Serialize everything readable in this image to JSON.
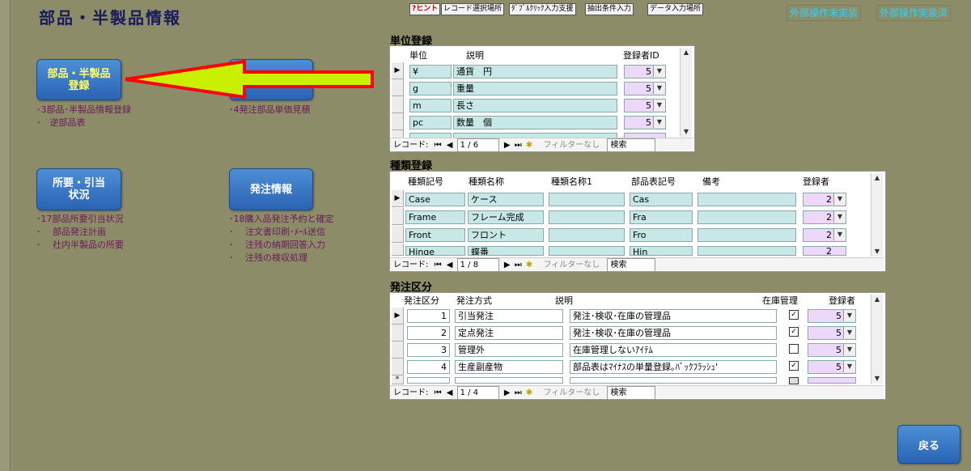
{
  "page": {
    "title": "部品・半製品情報"
  },
  "toolbar": {
    "hint": "?ヒント",
    "record_select": "レコード選択場所",
    "double_click": "ﾀﾞﾌﾞﾙｸﾘｯｸ入力支援",
    "filter_cond": "抽出条件入力",
    "data_entry": "データ入力場所",
    "ext_not_impl": "外部操作未実装",
    "ext_impl": "外部操作実装済"
  },
  "nav_buttons": {
    "parts": "部品・半製品\n登録",
    "req": "所要・引当\n状況",
    "order": "発注情報"
  },
  "descriptions": {
    "parts": "･3部品･半製品情報登録\n･　逆部品表",
    "price": "･4発注部品単価見積",
    "req": "･17部品所要引当状況\n･　 部品発注計画\n･　 社内半製品の所要",
    "order": "･18購入品発注予約と確定\n･　 注文書印刷･ﾒｰﾙ送信\n･　 注残の納期回答入力\n･　 注残の検収処理"
  },
  "unit_section": {
    "title": "単位登録",
    "headers": [
      "単位",
      "説明",
      "登録者ID"
    ],
    "rows": [
      {
        "unit": "¥",
        "desc": "通貨　円",
        "id": "5"
      },
      {
        "unit": "g",
        "desc": "重量",
        "id": "5"
      },
      {
        "unit": "m",
        "desc": "長さ",
        "id": "5"
      },
      {
        "unit": "pc",
        "desc": "数量　個",
        "id": "5"
      },
      {
        "unit": "",
        "desc": "",
        "id": ""
      }
    ],
    "record_label": "レコード:",
    "record_pos": "1 / 6",
    "filter": "フィルターなし",
    "search": "検索"
  },
  "type_section": {
    "title": "種類登録",
    "headers": [
      "種類記号",
      "種類名称",
      "種類名称1",
      "部品表記号",
      "備考",
      "登録者"
    ],
    "rows": [
      {
        "code": "Case",
        "name": "ケース",
        "name1": "",
        "bom": "Cas",
        "note": "",
        "reg": "2"
      },
      {
        "code": "Frame",
        "name": "フレーム完成",
        "name1": "",
        "bom": "Fra",
        "note": "",
        "reg": "2"
      },
      {
        "code": "Front",
        "name": "フロント",
        "name1": "",
        "bom": "Fro",
        "note": "",
        "reg": "2"
      },
      {
        "code": "Hinge",
        "name": "蝶番",
        "name1": "",
        "bom": "Hin",
        "note": "",
        "reg": "2"
      }
    ],
    "record_label": "レコード:",
    "record_pos": "1 / 8",
    "filter": "フィルターなし",
    "search": "検索"
  },
  "order_section": {
    "title": "発注区分",
    "headers": [
      "発注区分",
      "発注方式",
      "説明",
      "在庫管理",
      "登録者"
    ],
    "rows": [
      {
        "kbn": "1",
        "method": "引当発注",
        "desc": "発注･検収･在庫の管理品",
        "stock": true,
        "reg": "5"
      },
      {
        "kbn": "2",
        "method": "定点発注",
        "desc": "発注･検収･在庫の管理品",
        "stock": true,
        "reg": "5"
      },
      {
        "kbn": "3",
        "method": "管理外",
        "desc": "在庫管理しないｱｲﾃﾑ",
        "stock": false,
        "reg": "5"
      },
      {
        "kbn": "4",
        "method": "生産副産物",
        "desc": "部品表はﾏｲﾅｽの単量登録｡ﾊﾞｯｸﾌﾗｯｼｭ'",
        "stock": true,
        "reg": "5"
      }
    ],
    "new_marker": "*",
    "record_label": "レコード:",
    "record_pos": "1 / 4",
    "filter": "フィルターなし",
    "search": "検索"
  },
  "back_button": "戻る",
  "colors": {
    "background": "#8c8c68",
    "button": "#2a63b3",
    "arrow_fill": "#c8f000",
    "arrow_stroke": "#ff0000",
    "cyan_text": "#2ad6ff"
  }
}
